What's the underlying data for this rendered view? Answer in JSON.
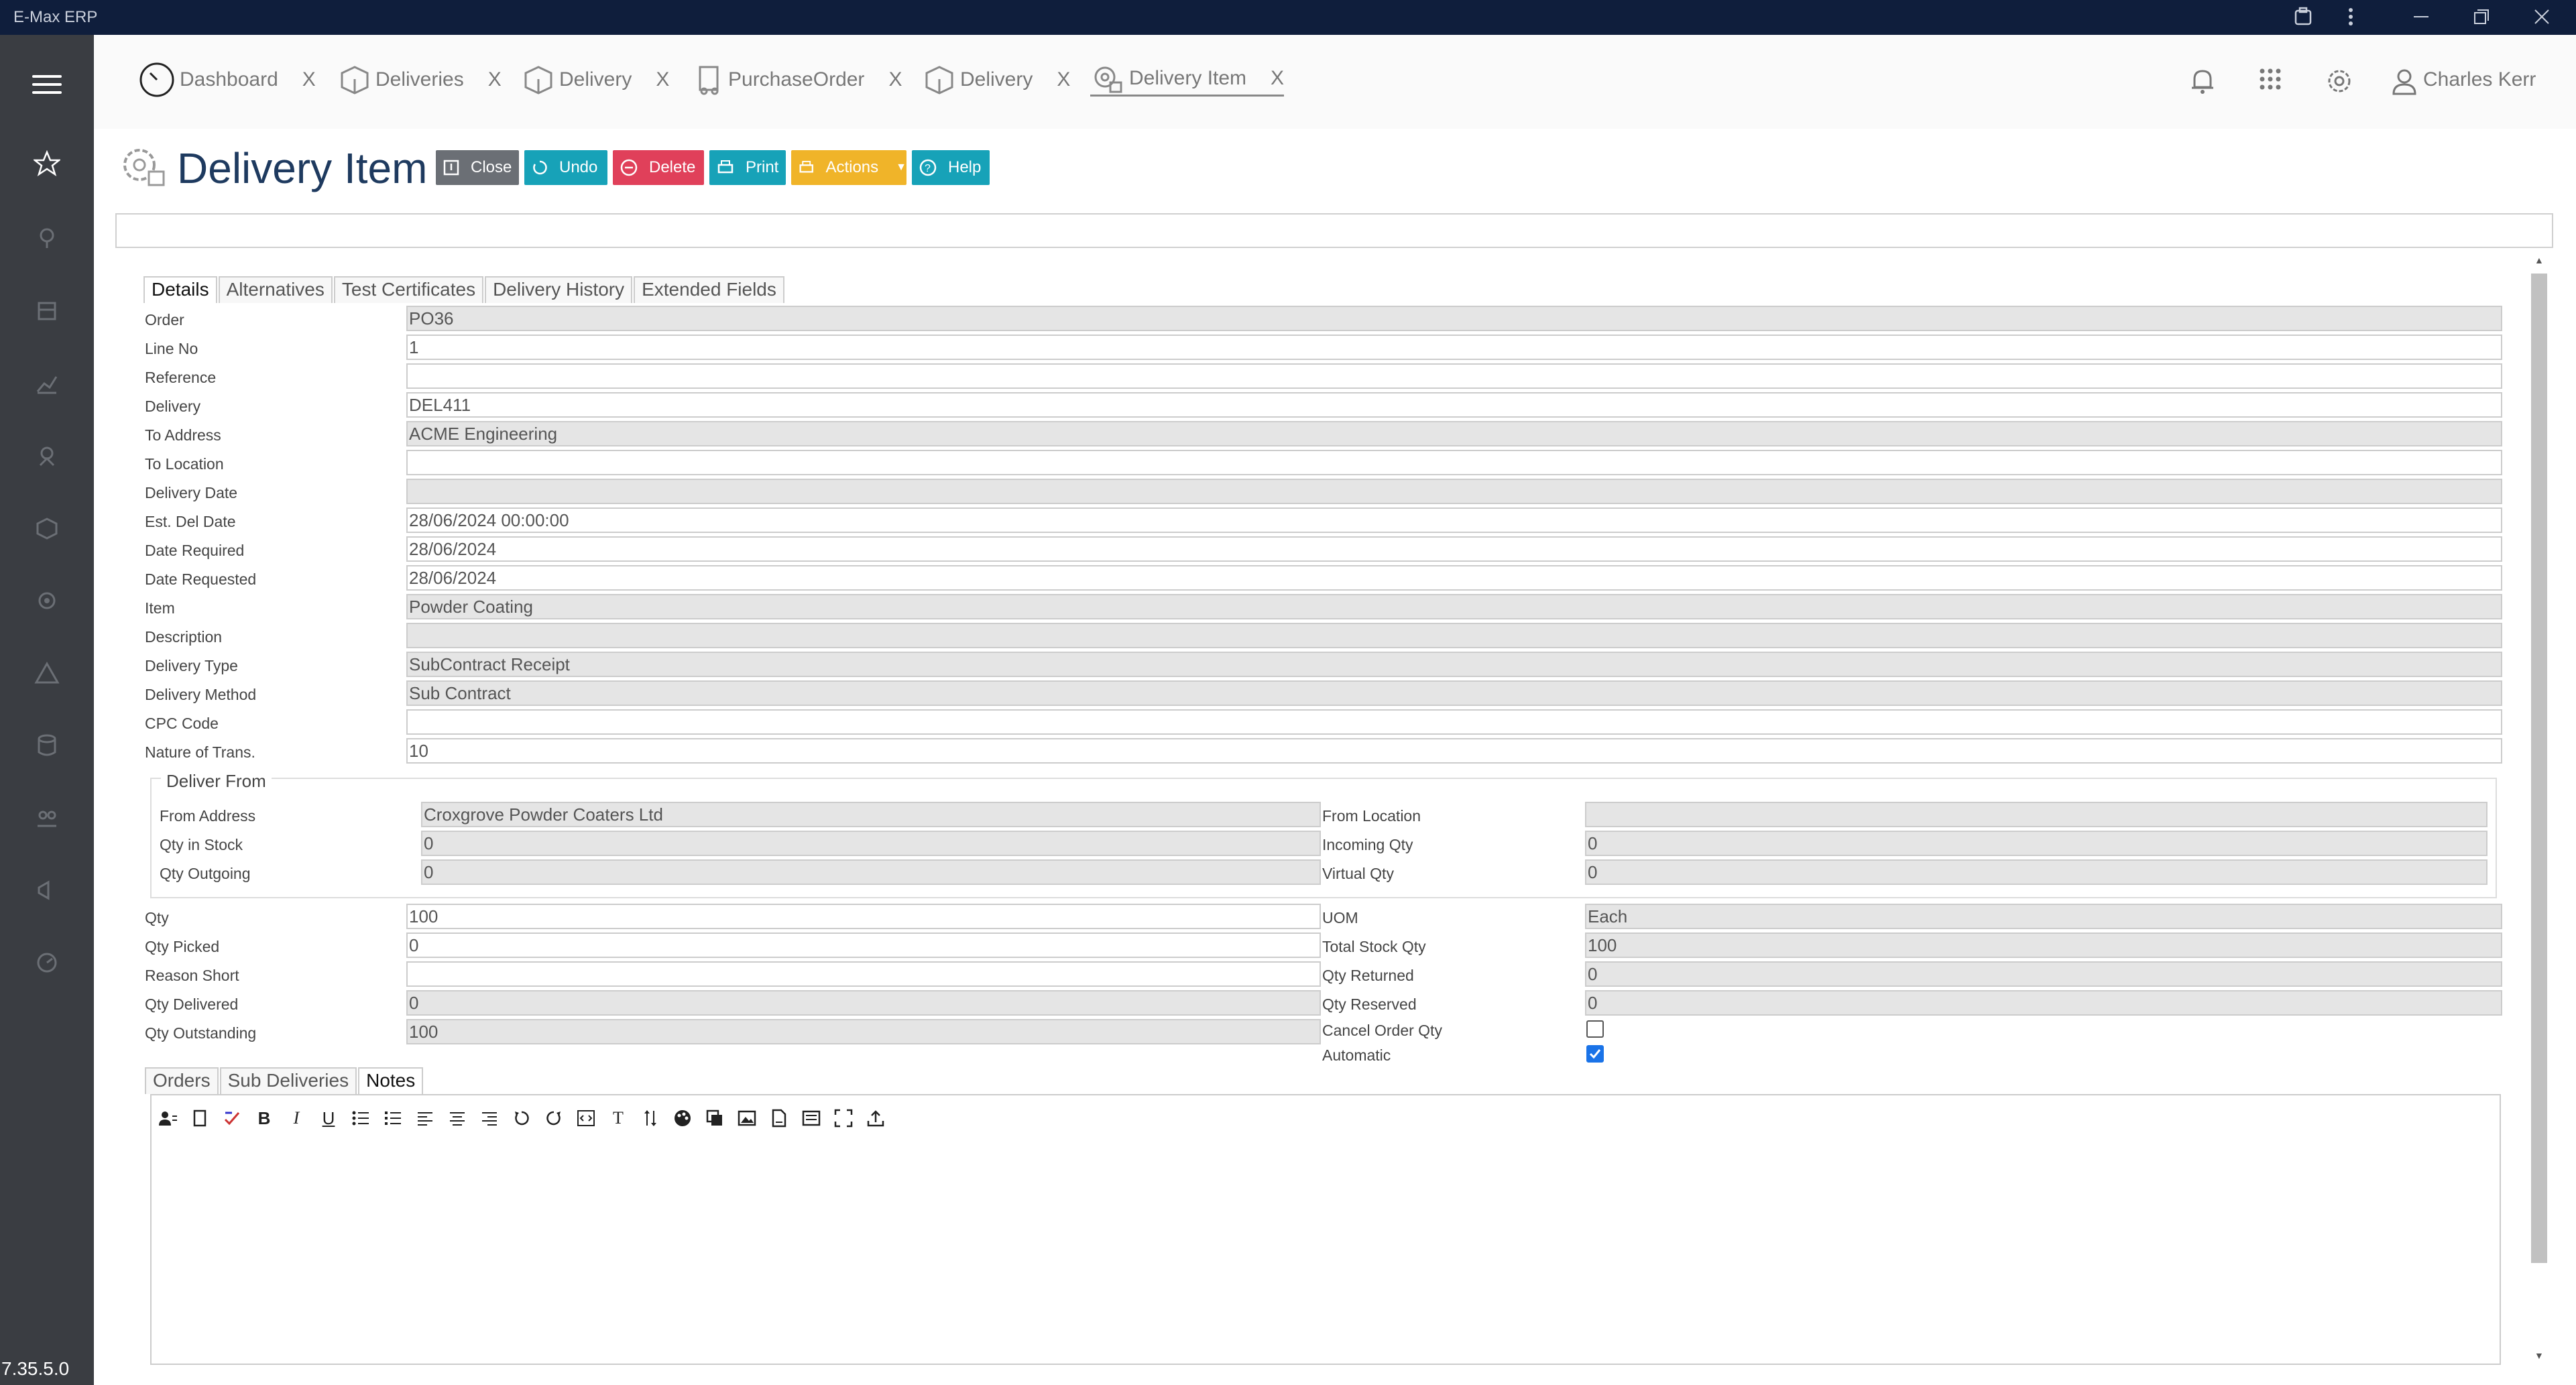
{
  "window": {
    "title": "E-Max ERP"
  },
  "sidebar": {
    "version": "7.35.5.0"
  },
  "tabs": [
    {
      "label": "Dashboard",
      "close": "X"
    },
    {
      "label": "Deliveries",
      "close": "X"
    },
    {
      "label": "Delivery",
      "close": "X"
    },
    {
      "label": "PurchaseOrder",
      "close": "X"
    },
    {
      "label": "Delivery",
      "close": "X"
    },
    {
      "label": "Delivery Item",
      "close": "X"
    }
  ],
  "user": {
    "name": "Charles Kerr"
  },
  "page": {
    "title": "Delivery Item"
  },
  "toolbar": {
    "close": "Close",
    "undo": "Undo",
    "delete": "Delete",
    "print": "Print",
    "actions": "Actions",
    "help": "Help"
  },
  "colors": {
    "close": "#6b6f75",
    "undo": "#17a2b8",
    "delete": "#e0405a",
    "print": "#17a2b8",
    "actions": "#f0b429",
    "help": "#17a2b8",
    "sidebar": "#3a3d42",
    "titlebar": "#0f1e3c"
  },
  "detail_tabs": [
    "Details",
    "Alternatives",
    "Test Certificates",
    "Delivery History",
    "Extended Fields"
  ],
  "fields": {
    "order": {
      "label": "Order",
      "value": "PO36"
    },
    "line_no": {
      "label": "Line No",
      "value": "1"
    },
    "reference": {
      "label": "Reference",
      "value": ""
    },
    "delivery": {
      "label": "Delivery",
      "value": "DEL411"
    },
    "to_address": {
      "label": "To Address",
      "value": "ACME Engineering"
    },
    "to_location": {
      "label": "To Location",
      "value": ""
    },
    "delivery_date": {
      "label": "Delivery Date",
      "value": ""
    },
    "est_del_date": {
      "label": "Est. Del Date",
      "value": "28/06/2024 00:00:00"
    },
    "date_required": {
      "label": "Date Required",
      "value": "28/06/2024"
    },
    "date_requested": {
      "label": "Date Requested",
      "value": "28/06/2024"
    },
    "item": {
      "label": "Item",
      "value": "Powder Coating"
    },
    "description": {
      "label": "Description",
      "value": ""
    },
    "delivery_type": {
      "label": "Delivery Type",
      "value": "SubContract Receipt"
    },
    "delivery_method": {
      "label": "Delivery Method",
      "value": "Sub Contract"
    },
    "cpc_code": {
      "label": "CPC Code",
      "value": ""
    },
    "nature_of_trans": {
      "label": "Nature of Trans.",
      "value": "10"
    }
  },
  "deliver_from": {
    "legend": "Deliver From",
    "from_address": {
      "label": "From Address",
      "value": "Croxgrove Powder Coaters Ltd"
    },
    "qty_in_stock": {
      "label": "Qty in Stock",
      "value": "0"
    },
    "qty_outgoing": {
      "label": "Qty Outgoing",
      "value": "0"
    },
    "from_location": {
      "label": "From Location",
      "value": ""
    },
    "incoming_qty": {
      "label": "Incoming Qty",
      "value": "0"
    },
    "virtual_qty": {
      "label": "Virtual Qty",
      "value": "0"
    }
  },
  "quantities": {
    "qty": {
      "label": "Qty",
      "value": "100"
    },
    "qty_picked": {
      "label": "Qty Picked",
      "value": "0"
    },
    "reason_short": {
      "label": "Reason Short",
      "value": ""
    },
    "qty_delivered": {
      "label": "Qty Delivered",
      "value": "0"
    },
    "qty_outstanding": {
      "label": "Qty Outstanding",
      "value": "100"
    },
    "uom": {
      "label": "UOM",
      "value": "Each"
    },
    "total_stock_qty": {
      "label": "Total Stock Qty",
      "value": "100"
    },
    "qty_returned": {
      "label": "Qty Returned",
      "value": "0"
    },
    "qty_reserved": {
      "label": "Qty Reserved",
      "value": "0"
    },
    "cancel_order_qty": {
      "label": "Cancel Order Qty",
      "checked": false
    },
    "automatic": {
      "label": "Automatic",
      "checked": true
    }
  },
  "bottom_tabs": [
    "Orders",
    "Sub Deliveries",
    "Notes"
  ],
  "editor_toolbar": [
    "contact-icon",
    "bookmark-icon",
    "spellcheck-icon",
    "bold-icon",
    "italic-icon",
    "underline-icon",
    "bullet-list-icon",
    "numbered-list-icon",
    "align-left-icon",
    "align-center-icon",
    "align-right-icon",
    "undo-icon",
    "redo-icon",
    "source-code-icon",
    "text-format-icon",
    "line-height-icon",
    "color-palette-icon",
    "copy-format-icon",
    "image-icon",
    "file-icon",
    "template-icon",
    "fullscreen-icon",
    "upload-icon"
  ],
  "editor_glyphs": {
    "bold": "B",
    "italic": "I",
    "underline": "U",
    "text": "T"
  }
}
